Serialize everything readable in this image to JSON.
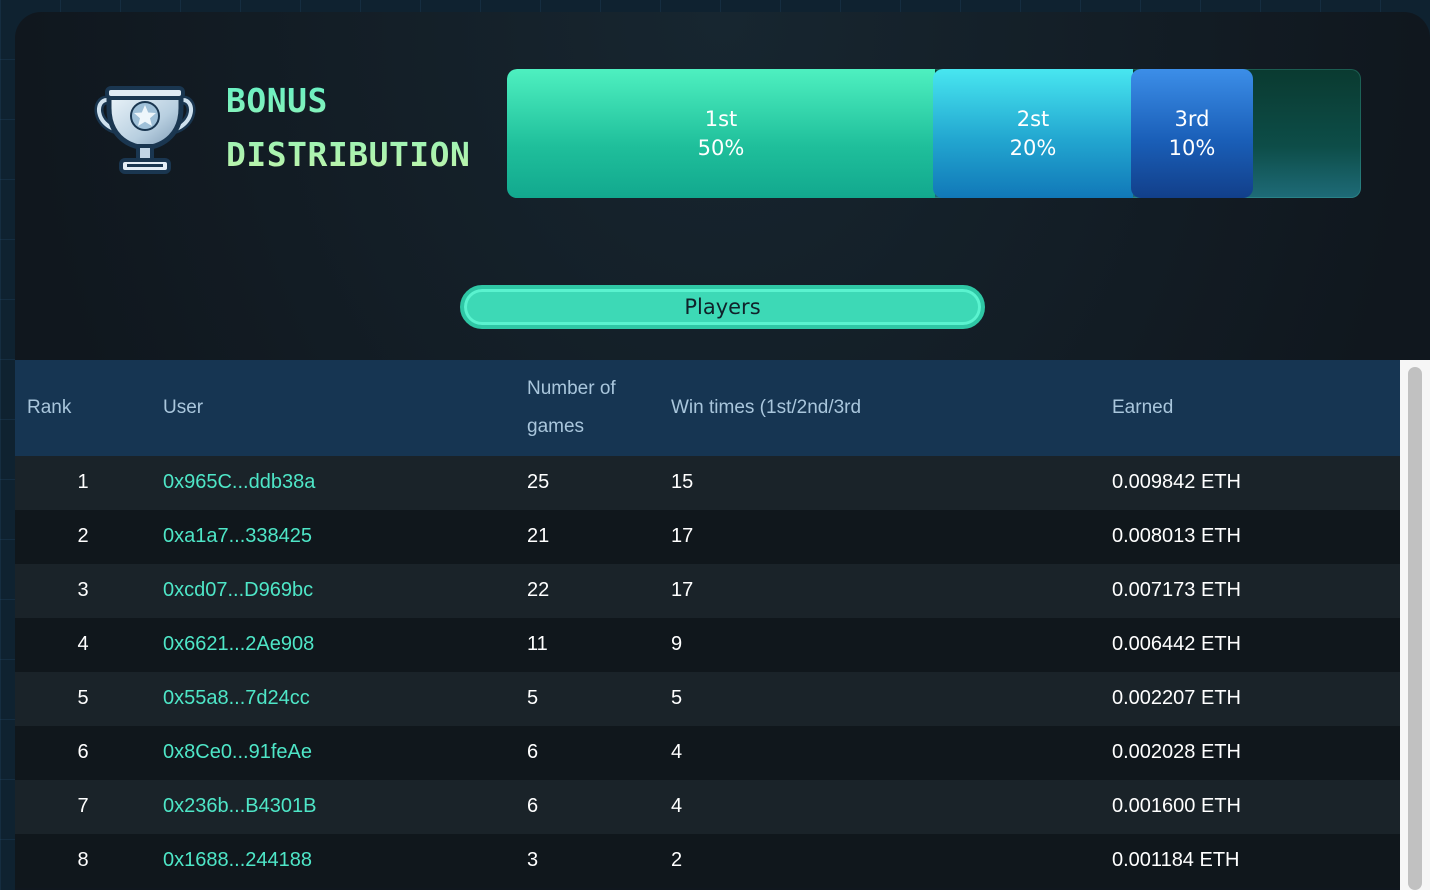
{
  "header": {
    "title_line1": "BONUS",
    "title_line2": "DISTRIBUTION"
  },
  "distribution": [
    {
      "place": "1st",
      "percent": "50%",
      "share": 0.5
    },
    {
      "place": "2st",
      "percent": "20%",
      "share": 0.2
    },
    {
      "place": "3rd",
      "percent": "10%",
      "share": 0.1
    }
  ],
  "tab": {
    "label": "Players"
  },
  "table": {
    "columns": {
      "rank": "Rank",
      "user": "User",
      "games_line1": "Number of",
      "games_line2": "games",
      "wins": "Win times (1st/2nd/3rd",
      "earned": "Earned"
    },
    "rows": [
      {
        "rank": "1",
        "user": "0x965C...ddb38a",
        "games": "25",
        "wins": "15",
        "earned": "0.009842 ETH"
      },
      {
        "rank": "2",
        "user": "0xa1a7...338425",
        "games": "21",
        "wins": "17",
        "earned": "0.008013 ETH"
      },
      {
        "rank": "3",
        "user": "0xcd07...D969bc",
        "games": "22",
        "wins": "17",
        "earned": "0.007173 ETH"
      },
      {
        "rank": "4",
        "user": "0x6621...2Ae908",
        "games": "11",
        "wins": "9",
        "earned": "0.006442 ETH"
      },
      {
        "rank": "5",
        "user": "0x55a8...7d24cc",
        "games": "5",
        "wins": "5",
        "earned": "0.002207 ETH"
      },
      {
        "rank": "6",
        "user": "0x8Ce0...91feAe",
        "games": "6",
        "wins": "4",
        "earned": "0.002028 ETH"
      },
      {
        "rank": "7",
        "user": "0x236b...B4301B",
        "games": "6",
        "wins": "4",
        "earned": "0.001600 ETH"
      },
      {
        "rank": "8",
        "user": "0x1688...244188",
        "games": "3",
        "wins": "2",
        "earned": "0.001184 ETH"
      }
    ]
  },
  "icons": {
    "trophy": "trophy-icon"
  },
  "colors": {
    "accent": "#4ee6c7",
    "header_bg": "#163552",
    "first": "#2fd3a8",
    "second": "#2aa8d8",
    "third": "#1a5fb8"
  }
}
